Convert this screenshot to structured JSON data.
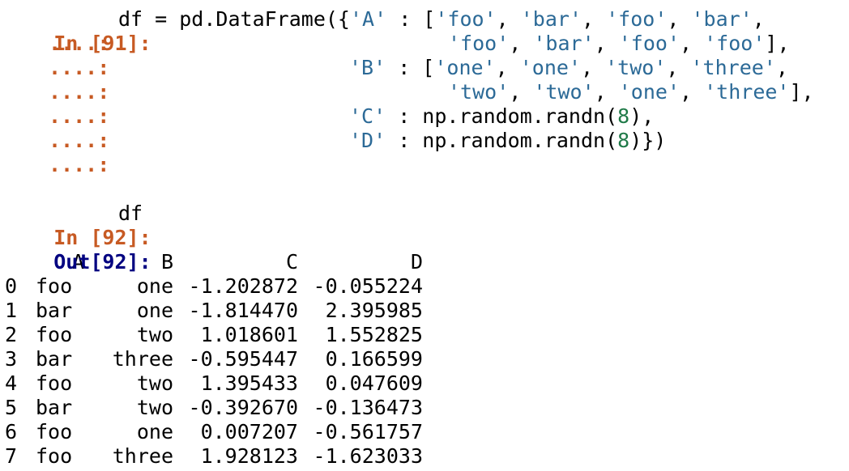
{
  "cell91": {
    "in_prompt": "In [91]:",
    "cont_prompt": "....:",
    "line1": {
      "a": "df = pd.DataFrame({",
      "key": "'A'",
      "sep": " : [",
      "items": [
        "'foo'",
        "'bar'",
        "'foo'",
        "'bar'"
      ],
      "tail": ","
    },
    "line2": {
      "items": [
        "'foo'",
        "'bar'",
        "'foo'",
        "'foo'"
      ],
      "tail": "],"
    },
    "line3": {
      "key": "'B'",
      "sep": " : [",
      "items": [
        "'one'",
        "'one'",
        "'two'",
        "'three'"
      ],
      "tail": ","
    },
    "line4": {
      "items": [
        "'two'",
        "'two'",
        "'one'",
        "'three'"
      ],
      "tail": "],"
    },
    "line5": {
      "key": "'C'",
      "sep": " : np.random.randn(",
      "num": "8",
      "tail": "),"
    },
    "line6": {
      "key": "'D'",
      "sep": " : np.random.randn(",
      "num": "8",
      "tail": ")})"
    }
  },
  "cell92": {
    "in_prompt": "In [92]:",
    "input": "df",
    "out_prompt": "Out[92]:"
  },
  "dataframe": {
    "columns": [
      "A",
      "B",
      "C",
      "D"
    ],
    "rows": [
      {
        "index": "0",
        "A": "foo",
        "B": "one",
        "C": "-1.202872",
        "D": "-0.055224"
      },
      {
        "index": "1",
        "A": "bar",
        "B": "one",
        "C": "-1.814470",
        "D": "2.395985"
      },
      {
        "index": "2",
        "A": "foo",
        "B": "two",
        "C": "1.018601",
        "D": "1.552825"
      },
      {
        "index": "3",
        "A": "bar",
        "B": "three",
        "C": "-0.595447",
        "D": "0.166599"
      },
      {
        "index": "4",
        "A": "foo",
        "B": "two",
        "C": "1.395433",
        "D": "0.047609"
      },
      {
        "index": "5",
        "A": "bar",
        "B": "two",
        "C": "-0.392670",
        "D": "-0.136473"
      },
      {
        "index": "6",
        "A": "foo",
        "B": "one",
        "C": "0.007207",
        "D": "-0.561757"
      },
      {
        "index": "7",
        "A": "foo",
        "B": "three",
        "C": "1.928123",
        "D": "-1.623033"
      }
    ]
  },
  "colors": {
    "prompt_in": "#c75a23",
    "prompt_out": "#000080",
    "string": "#2c6a97",
    "number": "#1f7a48"
  }
}
